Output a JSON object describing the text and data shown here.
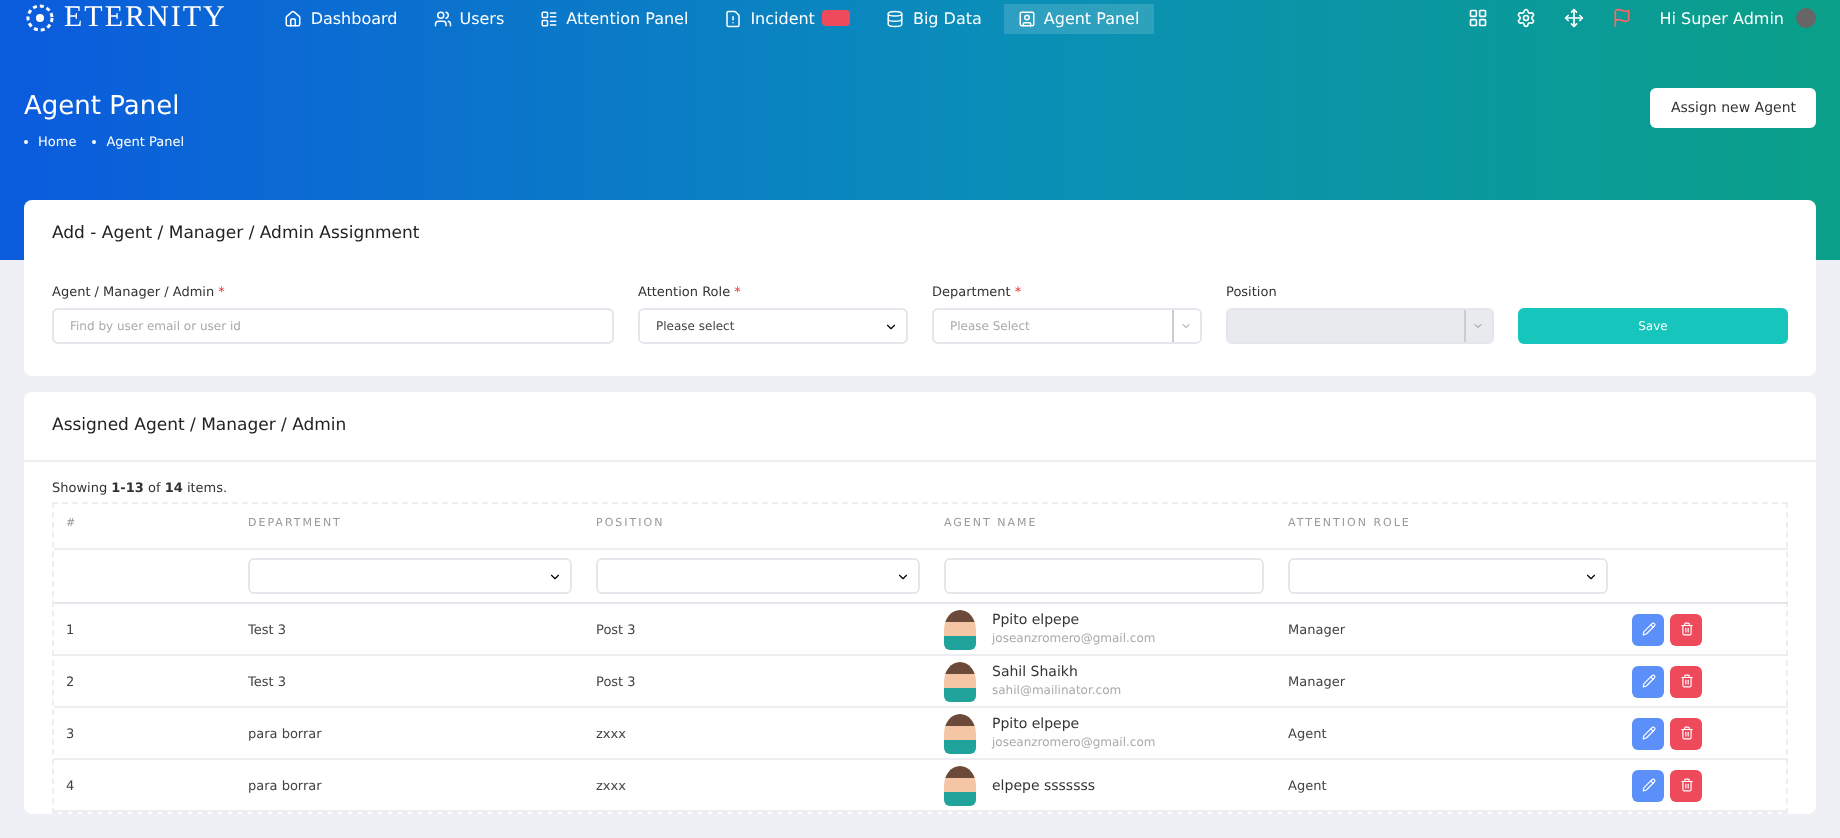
{
  "brand": "ETERNITY",
  "nav": [
    {
      "label": "Dashboard",
      "selected": false,
      "alert": false
    },
    {
      "label": "Users",
      "selected": false,
      "alert": false
    },
    {
      "label": "Attention Panel",
      "selected": false,
      "alert": false
    },
    {
      "label": "Incident",
      "selected": false,
      "alert": true
    },
    {
      "label": "Big Data",
      "selected": false,
      "alert": false
    },
    {
      "label": "Agent Panel",
      "selected": true,
      "alert": false
    }
  ],
  "user": {
    "greeting": "Hi Super Admin"
  },
  "page": {
    "title": "Agent Panel",
    "breadcrumb": [
      "Home",
      "Agent Panel"
    ],
    "action": "Assign new Agent"
  },
  "form": {
    "title": "Add - Agent / Manager / Admin Assignment",
    "fields": [
      {
        "kind": "input",
        "label": "Agent / Manager / Admin",
        "required": true,
        "required_mark": "*",
        "placeholder": "Find by user email or user id",
        "disabled": false
      },
      {
        "kind": "select",
        "label": "Attention Role",
        "required": true,
        "required_mark": "*",
        "placeholder": "Please select",
        "disabled": false
      },
      {
        "kind": "combo",
        "label": "Department",
        "required": true,
        "required_mark": "*",
        "placeholder": "Please Select",
        "disabled": false
      },
      {
        "kind": "combo",
        "label": "Position",
        "required": false,
        "disabled": true
      }
    ],
    "save": "Save"
  },
  "table": {
    "title": "Assigned Agent / Manager / Admin",
    "summary": "Showing **1-13** of **14** items.",
    "columns": [
      {
        "label": "#",
        "kind": "none"
      },
      {
        "label": "DEPARTMENT",
        "kind": "select"
      },
      {
        "label": "POSITION",
        "kind": "select"
      },
      {
        "label": "AGENT NAME",
        "kind": "input"
      },
      {
        "label": "ATTENTION ROLE",
        "kind": "select"
      }
    ],
    "rows": [
      {
        "num": "1",
        "department": "Test 3",
        "position": "Post 3",
        "name": "Ppito elpepe",
        "email": "joseanzromero@gmail.com",
        "role": "Manager"
      },
      {
        "num": "2",
        "department": "Test 3",
        "position": "Post 3",
        "name": "Sahil Shaikh",
        "email": "sahil@mailinator.com",
        "role": "Manager"
      },
      {
        "num": "3",
        "department": "para borrar",
        "position": "zxxx",
        "name": "Ppito elpepe",
        "email": "joseanzromero@gmail.com",
        "role": "Agent"
      },
      {
        "num": "4",
        "department": "para borrar",
        "position": "zxxx",
        "name": "elpepe sssssss",
        "email": "",
        "role": "Agent"
      }
    ]
  }
}
